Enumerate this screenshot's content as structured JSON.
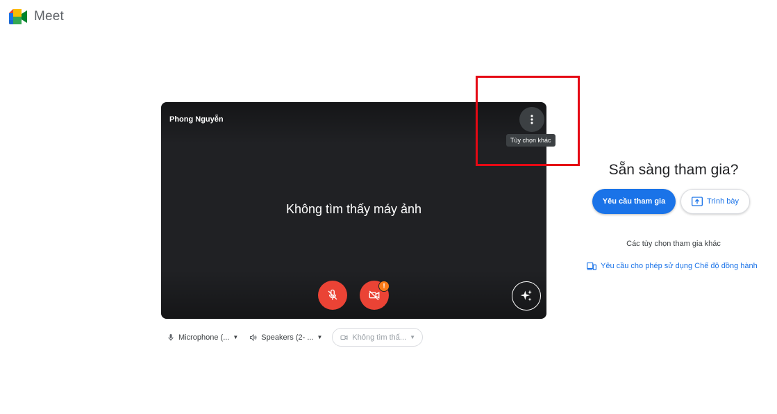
{
  "app": {
    "name": "Meet"
  },
  "preview": {
    "participant_name": "Phong Nguyễn",
    "no_camera_message": "Không tìm thấy máy ảnh",
    "more_options_tooltip": "Tùy chọn khác",
    "camera_warning_badge": "!"
  },
  "devices": {
    "microphone": "Microphone (...",
    "speakers": "Speakers (2- ...",
    "camera": "Không tìm thấ..."
  },
  "join_panel": {
    "title": "Sẵn sàng tham gia?",
    "join_button": "Yêu cầu tham gia",
    "present_button": "Trình bày",
    "other_options": "Các tùy chọn tham gia khác",
    "companion_link": "Yêu cầu cho phép sử dụng Chế độ đồng hành"
  },
  "colors": {
    "accent": "#1a73e8",
    "danger": "#ea4335",
    "warning": "#fa7b17",
    "highlight": "#e50914"
  }
}
